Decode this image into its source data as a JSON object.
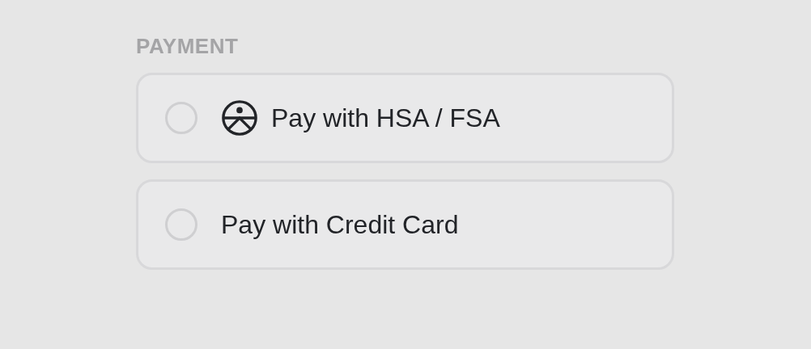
{
  "section_label": "PAYMENT",
  "options": [
    {
      "label": "Pay with HSA / FSA",
      "kind": "with-icon",
      "selected": false
    },
    {
      "label": "Pay with Credit Card",
      "kind": "plain",
      "selected": false
    }
  ]
}
